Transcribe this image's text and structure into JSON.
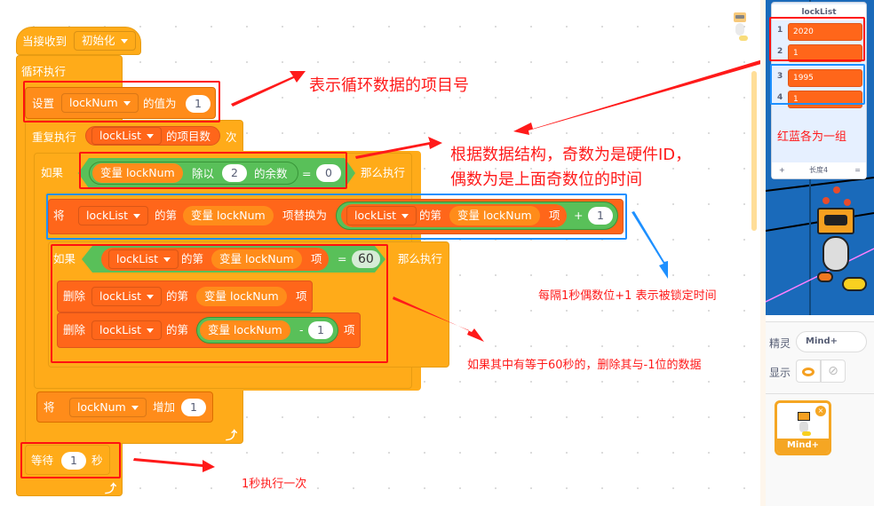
{
  "script": {
    "hat": {
      "label": "当接收到",
      "message": "初始化"
    },
    "forever": {
      "label": "循环执行"
    },
    "set_var": {
      "label": "设置",
      "variable": "lockNum",
      "label2": "的值为",
      "value": "1"
    },
    "repeat": {
      "label": "重复执行",
      "list": "lockList",
      "reporter_label": "的项目数",
      "label2": "次"
    },
    "if1": {
      "label": "如果",
      "var_prefix": "变量",
      "var": "lockNum",
      "op_label": "除以",
      "divisor": "2",
      "op_label2": "的余数",
      "eq": "=",
      "compare": "0",
      "then": "那么执行"
    },
    "replace": {
      "label": "将",
      "list": "lockList",
      "label2": "的第",
      "var_prefix": "变量",
      "var": "lockNum",
      "label3": "项替换为",
      "inner_list": "lockList",
      "inner_label": "的第",
      "inner_var_prefix": "变量",
      "inner_var": "lockNum",
      "inner_label2": "项",
      "plus": "+",
      "addend": "1"
    },
    "if2": {
      "label": "如果",
      "list": "lockList",
      "label2": "的第",
      "var_prefix": "变量",
      "var": "lockNum",
      "label3": "项",
      "eq": "=",
      "compare": "60",
      "then": "那么执行"
    },
    "delete1": {
      "label": "删除",
      "list": "lockList",
      "label2": "的第",
      "var_prefix": "变量",
      "var": "lockNum",
      "label3": "项"
    },
    "delete2": {
      "label": "删除",
      "list": "lockList",
      "label2": "的第",
      "var_prefix": "变量",
      "var": "lockNum",
      "minus": "-",
      "subtrahend": "1",
      "label3": "项"
    },
    "change_var": {
      "label": "将",
      "variable": "lockNum",
      "label2": "增加",
      "value": "1"
    },
    "wait": {
      "label": "等待",
      "value": "1",
      "label2": "秒"
    }
  },
  "annotations": {
    "loop_index": "表示循环数据的项目号",
    "structure_line1": "根据数据结构，奇数为是硬件ID，",
    "structure_line2": "偶数为是上面奇数位的时间",
    "increment": "每隔1秒偶数位+1 表示被锁定时间",
    "delete_note": "如果其中有等于60秒的，删除其与-1位的数据",
    "wait_note": "1秒执行一次",
    "group_note": "红蓝各为一组"
  },
  "list_monitor": {
    "title": "lockList",
    "items": [
      {
        "index": "1",
        "value": "2020"
      },
      {
        "index": "2",
        "value": "1"
      },
      {
        "index": "3",
        "value": "1995"
      },
      {
        "index": "4",
        "value": "1"
      }
    ],
    "add": "+",
    "length_label": "长度4",
    "resize": "="
  },
  "sprite_info": {
    "sprite_label": "精灵",
    "sprite_name": "Mind+",
    "show_label": "显示",
    "sprite_tile_name": "Mind+"
  },
  "colors": {
    "accent_red": "#ff1010",
    "accent_blue": "#1e90ff",
    "events": "#FFAB19",
    "variables": "#FF8C1A",
    "lists": "#FF661A",
    "operators": "#59C059"
  }
}
